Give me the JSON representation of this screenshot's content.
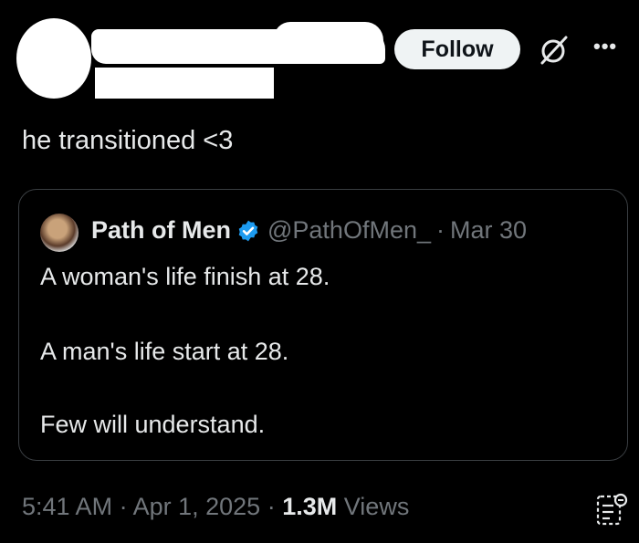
{
  "header": {
    "follow_label": "Follow",
    "icons": {
      "grok": "grok-icon",
      "more": "more-icon"
    }
  },
  "tweet": {
    "text": "he transitioned <3"
  },
  "quote": {
    "name": "Path of Men",
    "handle": "@PathOfMen_",
    "separator": "·",
    "date": "Mar 30",
    "lines": [
      "A woman's life finish at 28.",
      "A man's life start at 28.",
      "Few will understand."
    ]
  },
  "footer": {
    "time": "5:41 AM",
    "sep1": "·",
    "date": "Apr 1, 2025",
    "sep2": "·",
    "views_count": "1.3M",
    "views_label": "Views"
  },
  "colors": {
    "background": "#000000",
    "text": "#e7e9ea",
    "muted": "#71767b",
    "verified": "#1d9bf0",
    "button_bg": "#eff3f4"
  }
}
